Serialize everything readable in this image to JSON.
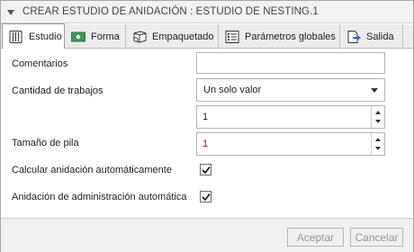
{
  "window": {
    "title": "CREAR ESTUDIO DE ANIDACIÓN : ESTUDIO DE NESTING.1",
    "collapse_icon": "collapse-triangle-icon"
  },
  "tabs": [
    {
      "label": "Estudio",
      "icon": "study-icon",
      "active": true
    },
    {
      "label": "Forma",
      "icon": "shape-icon",
      "active": false
    },
    {
      "label": "Empaquetado",
      "icon": "packaging-icon",
      "active": false
    },
    {
      "label": "Parámetros globales",
      "icon": "global-parameters-icon",
      "active": false
    },
    {
      "label": "Salida",
      "icon": "output-icon",
      "active": false
    }
  ],
  "form": {
    "comments": {
      "label": "Comentarios",
      "value": ""
    },
    "job_count": {
      "label": "Cantidad de trabajos",
      "selected": "Un solo valor",
      "value": "1"
    },
    "stack_size": {
      "label": "Tamaño de pila",
      "value": "1"
    },
    "auto_calc_nesting": {
      "label": "Calcular anidación automáticamente",
      "checked": true
    },
    "auto_admin_nesting": {
      "label": "Anidación de administración automática",
      "checked": true
    }
  },
  "footer": {
    "accept_label": "Aceptar",
    "cancel_label": "Cancelar"
  },
  "colors": {
    "title_bar_bg": "#f2f2f2",
    "tab_strip_bg": "#ececec",
    "disabled_button_text": "#9a9a9a",
    "stack_value_text": "#c00000",
    "shape_icon_green": "#3a9a52",
    "output_icon_blue": "#1b6fc8"
  }
}
